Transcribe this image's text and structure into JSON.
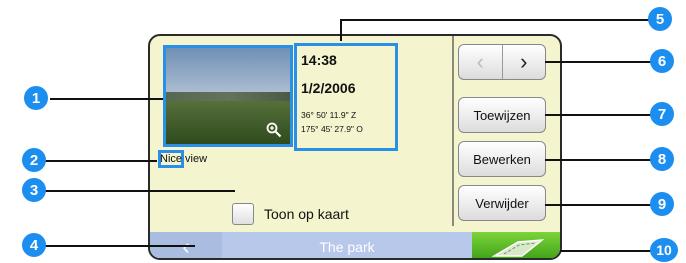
{
  "photo": {
    "caption": "Nice view"
  },
  "info": {
    "time": "14:38",
    "date": "1/2/2006",
    "coord_lat": "36° 50' 11.9\" Z",
    "coord_lon": "175° 45' 27.9\" O"
  },
  "nav": {
    "prev": "‹",
    "next": "›"
  },
  "buttons": {
    "assign": "Toewijzen",
    "edit": "Bewerken",
    "delete": "Verwijder"
  },
  "checkbox": {
    "label": "Toon op kaart"
  },
  "bottombar": {
    "back": "‹",
    "title": "The park"
  },
  "callouts": [
    "1",
    "2",
    "3",
    "4",
    "5",
    "6",
    "7",
    "8",
    "9",
    "10"
  ],
  "colors": {
    "callout": "#1b8ef0",
    "highlight": "#2a8fe6",
    "screen": "#f4f4cf",
    "bar": "#a9bde0",
    "go": "#3a9d16"
  },
  "icons": [
    "zoom-icon",
    "chevron-left-icon",
    "chevron-right-icon",
    "road-go-icon"
  ]
}
